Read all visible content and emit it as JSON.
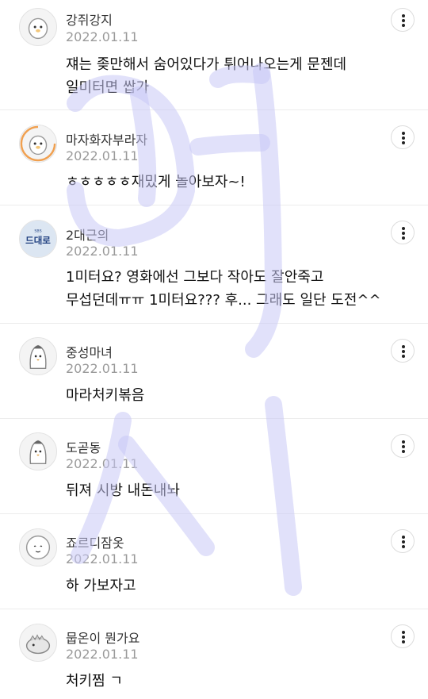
{
  "comments": [
    {
      "nickname": "강쥐강지",
      "date": "2022.01.11",
      "text": "쟤는 좆만해서 숨어있다가 튀어나오는게 문젠데\n일미터면 쌉가",
      "avatar_icon": "ghost-character-icon"
    },
    {
      "nickname": "마자화자부라자",
      "date": "2022.01.11",
      "text": "ㅎㅎㅎㅎㅎ재밌게 놀아보자~!",
      "avatar_icon": "ghost-character-icon"
    },
    {
      "nickname": "2대근의",
      "date": "2022.01.11",
      "text": "1미터요? 영화에선 그보다 작아도 잘안죽고\n무섭던데ㅠㅠ 1미터요??? 후... 그래도 일단 도전^^",
      "avatar_icon": "tv-show-logo-icon",
      "avatar_logo_small": "SBS",
      "avatar_logo_main": "드대로"
    },
    {
      "nickname": "중성마녀",
      "date": "2022.01.11",
      "text": "마라처키볶음",
      "avatar_icon": "penguin-character-icon"
    },
    {
      "nickname": "도곧동",
      "date": "2022.01.11",
      "text": "뒤져 시방 내돈내놔",
      "avatar_icon": "penguin-character-icon"
    },
    {
      "nickname": "죠르디잠옷",
      "date": "2022.01.11",
      "text": "하 가보자고",
      "avatar_icon": "round-face-character-icon"
    },
    {
      "nickname": "뭅온이 뭔가요",
      "date": "2022.01.11",
      "text": "처키찜 ㄱ",
      "avatar_icon": "dinosaur-character-icon"
    }
  ],
  "colors": {
    "watermark": "#c8c8f5",
    "date": "#9a9a9a",
    "divider": "#ececec",
    "progress_ring": "#f0a050"
  }
}
